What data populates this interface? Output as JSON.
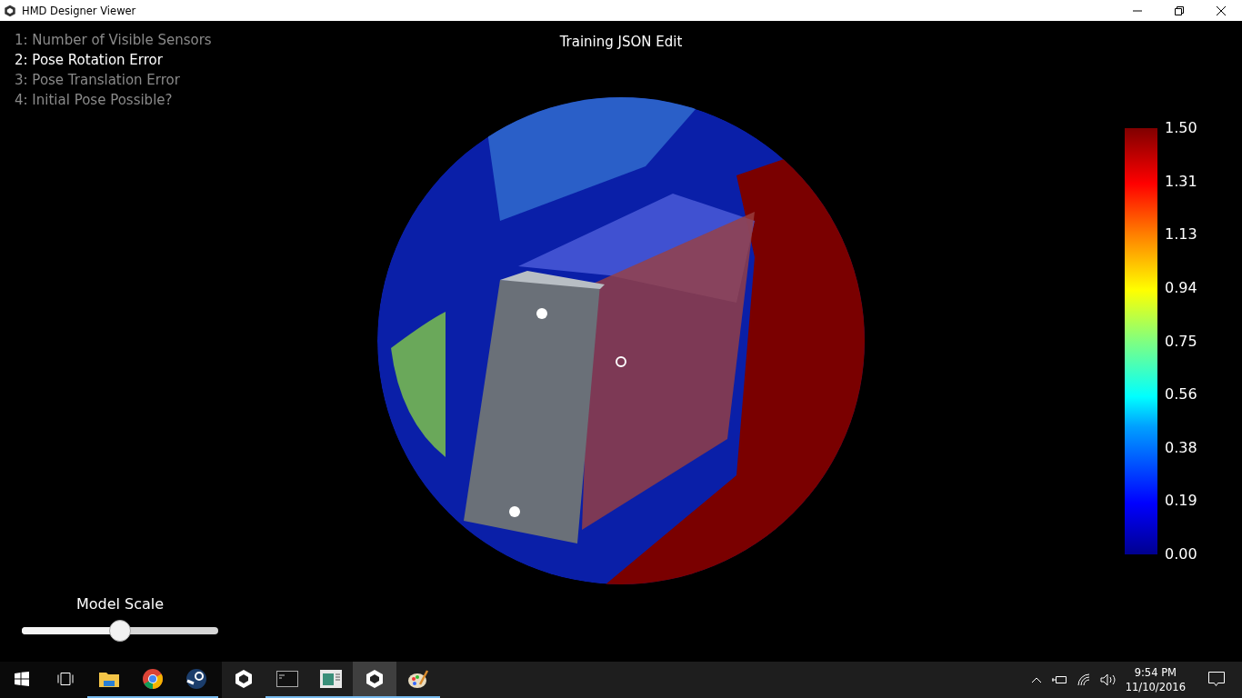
{
  "window": {
    "title": "HMD Designer Viewer"
  },
  "modes": [
    {
      "label": "1: Number of Visible Sensors",
      "selected": false
    },
    {
      "label": "2: Pose Rotation Error",
      "selected": true
    },
    {
      "label": "3: Pose Translation Error",
      "selected": false
    },
    {
      "label": "4: Initial Pose Possible?",
      "selected": false
    }
  ],
  "heading": "Training JSON Edit",
  "color_scale": {
    "labels": [
      "1.50",
      "1.31",
      "1.13",
      "0.94",
      "0.75",
      "0.56",
      "0.38",
      "0.19",
      "0.00"
    ]
  },
  "model_scale": {
    "label": "Model Scale",
    "level": 0.5
  },
  "taskbar": {
    "apps": [
      {
        "kind": "folder",
        "running": true,
        "selected": false
      },
      {
        "kind": "chrome",
        "running": true,
        "selected": false
      },
      {
        "kind": "steam",
        "running": true,
        "selected": false
      },
      {
        "kind": "unity",
        "running": false,
        "selected": false
      },
      {
        "kind": "console",
        "running": true,
        "selected": false
      },
      {
        "kind": "window",
        "running": true,
        "selected": false
      },
      {
        "kind": "unity",
        "running": true,
        "selected": true
      },
      {
        "kind": "paint",
        "running": true,
        "selected": false
      }
    ],
    "time": "9:54 PM",
    "date": "11/10/2016"
  }
}
